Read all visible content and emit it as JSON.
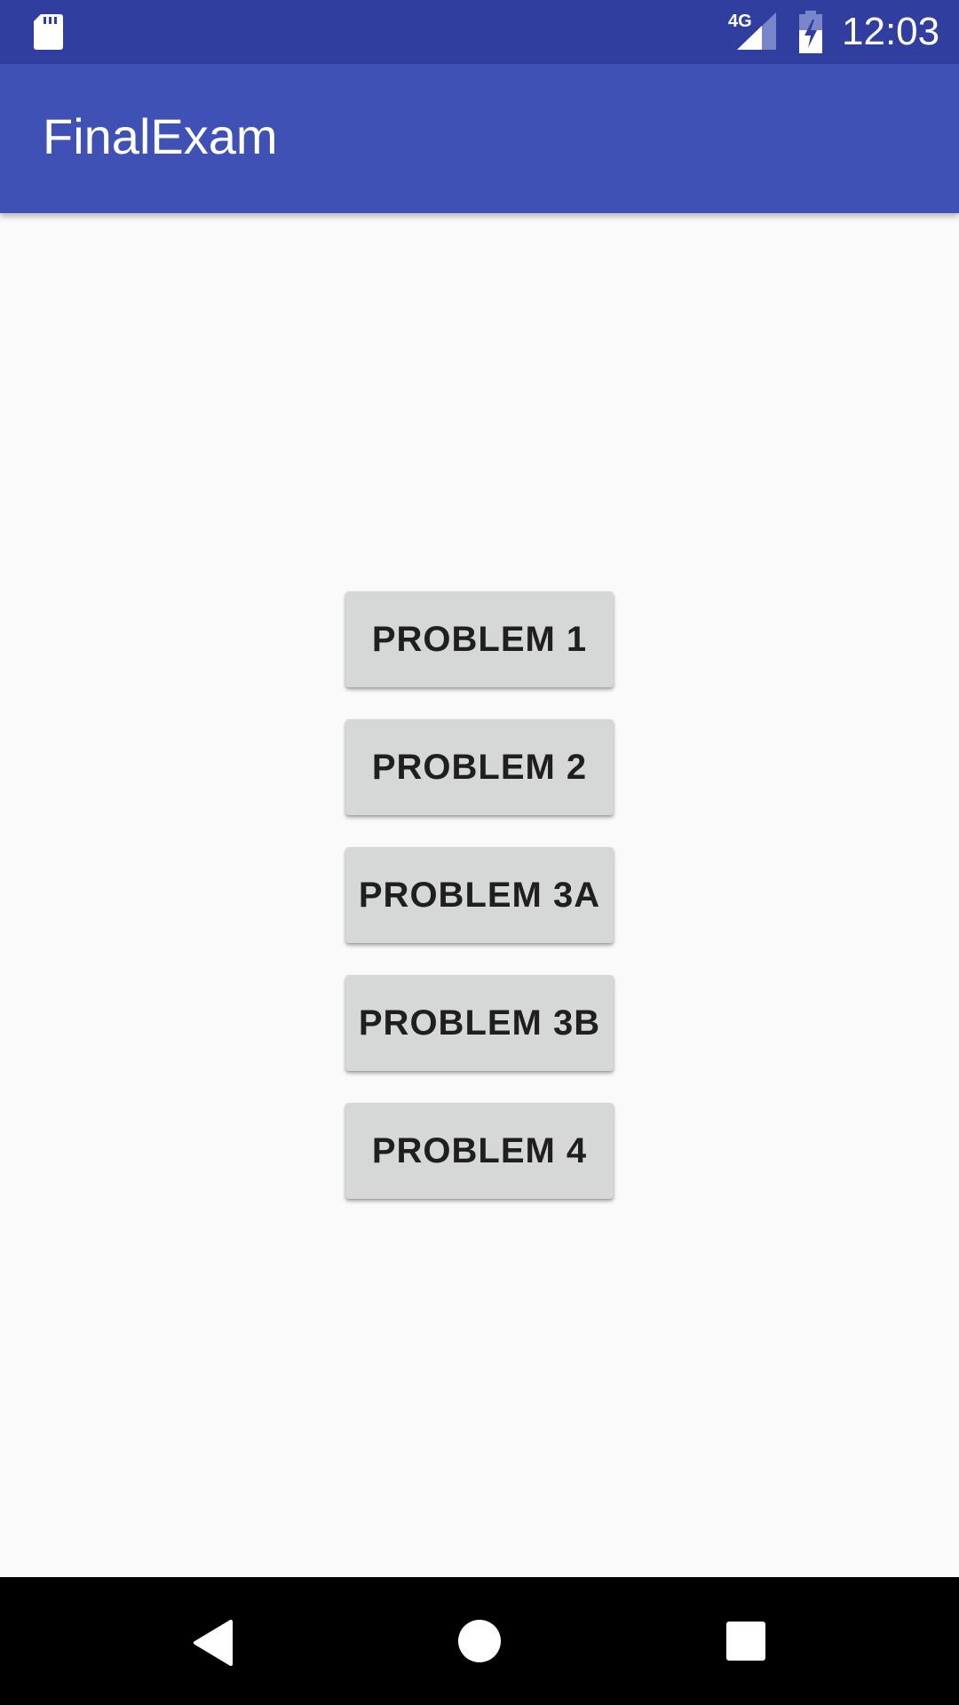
{
  "status_bar": {
    "network_label": "4G",
    "time": "12:03",
    "color": "#303f9f",
    "icons": [
      "sd-card-icon",
      "signal-icon",
      "battery-charging-icon"
    ]
  },
  "app_bar": {
    "title": "FinalExam",
    "color": "#3f51b5"
  },
  "main": {
    "buttons": [
      {
        "label": "PROBLEM 1"
      },
      {
        "label": "PROBLEM 2"
      },
      {
        "label": "PROBLEM 3A"
      },
      {
        "label": "PROBLEM 3B"
      },
      {
        "label": "PROBLEM 4"
      }
    ]
  },
  "nav_bar": {
    "icons": [
      "back-icon",
      "home-icon",
      "recents-icon"
    ]
  }
}
